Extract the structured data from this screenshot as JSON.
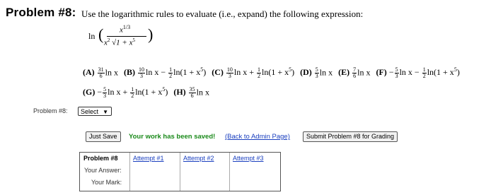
{
  "heading": "Problem #8:",
  "problem_text": "Use the logarithmic rules to evaluate (i.e., expand) the following expression:",
  "expression": {
    "ln": "ln",
    "numerator_base": "x",
    "numerator_exp": "1/3",
    "denominator_base": "x",
    "denominator_exp": "2",
    "denominator_root": "√1 + x",
    "denominator_root_exp": "5"
  },
  "choices_row1": [
    {
      "letter": "(A)",
      "n": "31",
      "d": "6",
      "rest": "ln x"
    },
    {
      "letter": "(B)",
      "n": "10",
      "d": "3",
      "rest": "ln x − ",
      "n2": "1",
      "d2": "2",
      "rest2": "ln(1 + x",
      "sup": "5",
      "tail": ")"
    },
    {
      "letter": "(C)",
      "n": "10",
      "d": "3",
      "rest": "ln x + ",
      "n2": "1",
      "d2": "2",
      "rest2": "ln(1 + x",
      "sup": "5",
      "tail": ")"
    },
    {
      "letter": "(D)",
      "n": "5",
      "d": "3",
      "rest": "ln x"
    },
    {
      "letter": "(E)",
      "n": "7",
      "d": "6",
      "rest": "ln x"
    },
    {
      "letter": "(F)",
      "pre": "−",
      "n": "5",
      "d": "3",
      "rest": "ln x − ",
      "n2": "1",
      "d2": "2",
      "rest2": "ln(1 + x",
      "sup": "5",
      "tail": ")"
    }
  ],
  "choices_row2": [
    {
      "letter": "(G)",
      "pre": "−",
      "n": "5",
      "d": "3",
      "rest": "ln x + ",
      "n2": "1",
      "d2": "2",
      "rest2": "ln(1 + x",
      "sup": "5",
      "tail": ")"
    },
    {
      "letter": "(H)",
      "n": "35",
      "d": "6",
      "rest": "ln x"
    }
  ],
  "select_label": "Problem #8:",
  "select_value": "Select",
  "buttons": {
    "just_save": "Just Save",
    "submit": "Submit Problem #8 for Grading"
  },
  "saved_message": "Your work has been saved!",
  "back_link": "(Back to Admin Page)",
  "attempts_table": {
    "title": "Problem #8",
    "attempts": [
      "Attempt #1",
      "Attempt #2",
      "Attempt #3"
    ],
    "row_labels": [
      "Your Answer:",
      "Your Mark:"
    ]
  }
}
